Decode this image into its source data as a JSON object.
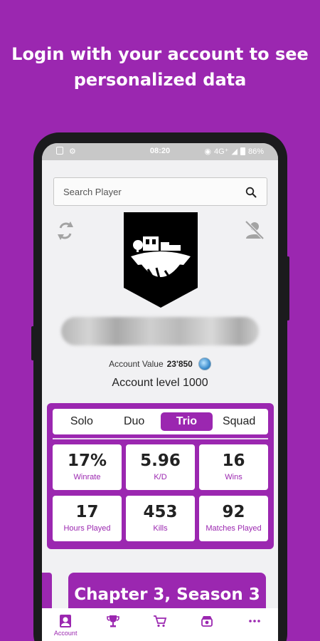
{
  "headline": {
    "line1": "Login with your account to see",
    "line2": "personalized data"
  },
  "statusbar": {
    "time": "08:20",
    "network": "4G⁺",
    "battery": "86%"
  },
  "search": {
    "placeholder": "Search Player"
  },
  "account": {
    "value_label": "Account Value",
    "value": "23'850",
    "level_text": "Account level 1000"
  },
  "modes": [
    "Solo",
    "Duo",
    "Trio",
    "Squad"
  ],
  "active_mode": "Trio",
  "stats": [
    {
      "value": "17%",
      "label": "Winrate"
    },
    {
      "value": "5.96",
      "label": "K/D"
    },
    {
      "value": "16",
      "label": "Wins"
    },
    {
      "value": "17",
      "label": "Hours Played"
    },
    {
      "value": "453",
      "label": "Kills"
    },
    {
      "value": "92",
      "label": "Matches Played"
    }
  ],
  "season": {
    "title": "Chapter 3, Season 3"
  },
  "bottom_nav": {
    "account_label": "Account",
    "icons": [
      "account-icon",
      "trophy-icon",
      "cart-icon",
      "shop-icon",
      "more-icon"
    ]
  },
  "colors": {
    "accent": "#9b27b0",
    "screen_bg": "#f1f1f3",
    "card_bg": "#ffffff"
  }
}
